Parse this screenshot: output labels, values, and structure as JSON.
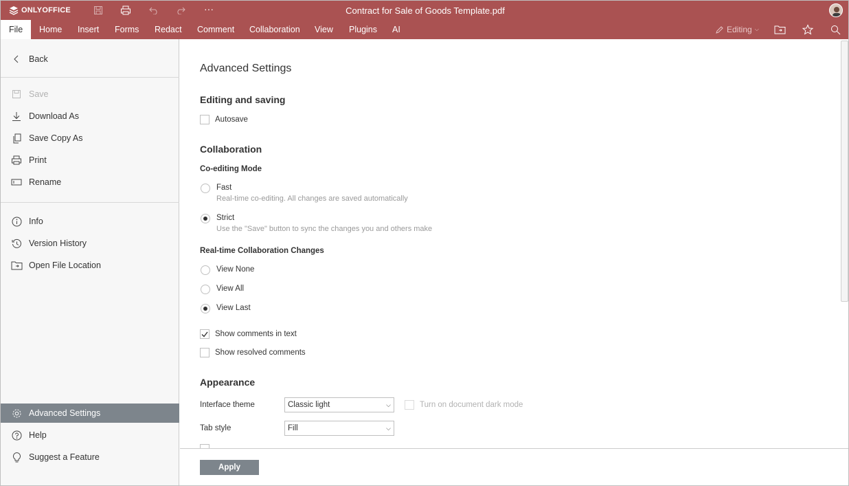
{
  "app": {
    "brand": "ONLYOFFICE",
    "document_title": "Contract for Sale of Goods Template.pdf"
  },
  "menu": {
    "tabs": [
      {
        "label": "File"
      },
      {
        "label": "Home"
      },
      {
        "label": "Insert"
      },
      {
        "label": "Forms"
      },
      {
        "label": "Redact"
      },
      {
        "label": "Comment"
      },
      {
        "label": "Collaboration"
      },
      {
        "label": "View"
      },
      {
        "label": "Plugins"
      },
      {
        "label": "AI"
      }
    ],
    "mode_label": "Editing"
  },
  "sidebar": {
    "back": "Back",
    "items": [
      {
        "label": "Save"
      },
      {
        "label": "Download As"
      },
      {
        "label": "Save Copy As"
      },
      {
        "label": "Print"
      },
      {
        "label": "Rename"
      },
      {
        "label": "Info"
      },
      {
        "label": "Version History"
      },
      {
        "label": "Open File Location"
      },
      {
        "label": "Advanced Settings"
      },
      {
        "label": "Help"
      },
      {
        "label": "Suggest a Feature"
      }
    ]
  },
  "settings": {
    "title": "Advanced Settings",
    "editing_section": "Editing and saving",
    "autosave": "Autosave",
    "collab_section": "Collaboration",
    "coediting_mode": "Co-editing Mode",
    "fast_label": "Fast",
    "fast_desc": "Real-time co-editing. All changes are saved automatically",
    "strict_label": "Strict",
    "strict_desc": "Use the \"Save\" button to sync the changes you and others make",
    "realtime_title": "Real-time Collaboration Changes",
    "view_none": "View None",
    "view_all": "View All",
    "view_last": "View Last",
    "show_comments": "Show comments in text",
    "show_resolved": "Show resolved comments",
    "appearance_section": "Appearance",
    "interface_theme_label": "Interface theme",
    "interface_theme_value": "Classic light",
    "dark_mode": "Turn on document dark mode",
    "tab_style_label": "Tab style",
    "tab_style_value": "Fill",
    "apply": "Apply"
  },
  "state": {
    "autosave": false,
    "coediting": "Strict",
    "realtime": "View Last",
    "show_comments": true,
    "show_resolved": false,
    "dark_mode": false
  },
  "colors": {
    "header": "#aa5252",
    "selected_item": "#7d858c"
  }
}
